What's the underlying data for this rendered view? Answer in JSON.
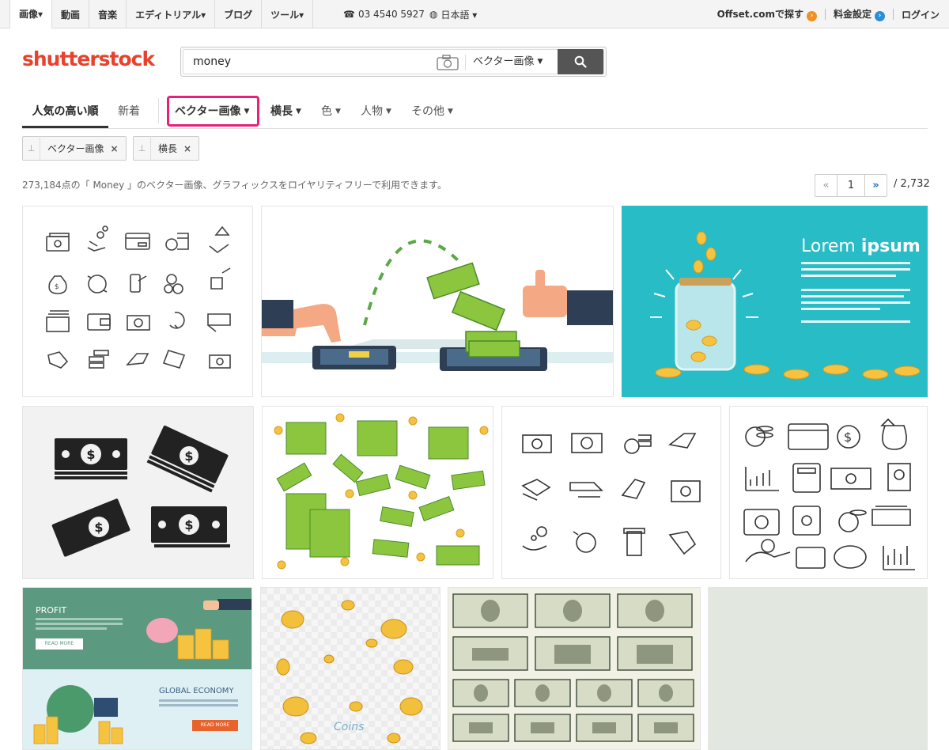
{
  "topnav": {
    "items": [
      {
        "label": "画像▾",
        "active": true
      },
      {
        "label": "動画"
      },
      {
        "label": "音楽"
      },
      {
        "label": "エディトリアル▾"
      },
      {
        "label": "ブログ"
      },
      {
        "label": "ツール▾"
      }
    ],
    "phone": "03 4540 5927",
    "language": "日本語 ▾",
    "offset": "Offset.comで探す",
    "pricing": "料金設定",
    "login": "ログイン"
  },
  "logo": "shutterstock",
  "search": {
    "query": "money",
    "type": "ベクター画像"
  },
  "tabs": {
    "popular": "人気の高い順",
    "newest": "新着",
    "vector": "ベクター画像",
    "orientation": "横長",
    "color": "色",
    "people": "人物",
    "more": "その他"
  },
  "chips": [
    "ベクター画像",
    "横長"
  ],
  "results_text": "273,184点の「 Money 」のベクター画像、グラフィックスをロイヤリティフリーで利用できます。",
  "pager": {
    "prev": "«",
    "page": "1",
    "next": "»",
    "total": "/ 2,732"
  },
  "tiles": {
    "lorem_title_1": "Lorem",
    "lorem_title_2": "ipsum",
    "profit": "PROFIT",
    "read_more": "READ MORE",
    "global_economy": "GLOBAL ECONOMY",
    "coins": "Coins"
  },
  "colors": {
    "brand": "#e8412c",
    "highlight": "#e8207b",
    "teal": "#27bcc6",
    "money_green": "#8cc63f"
  }
}
